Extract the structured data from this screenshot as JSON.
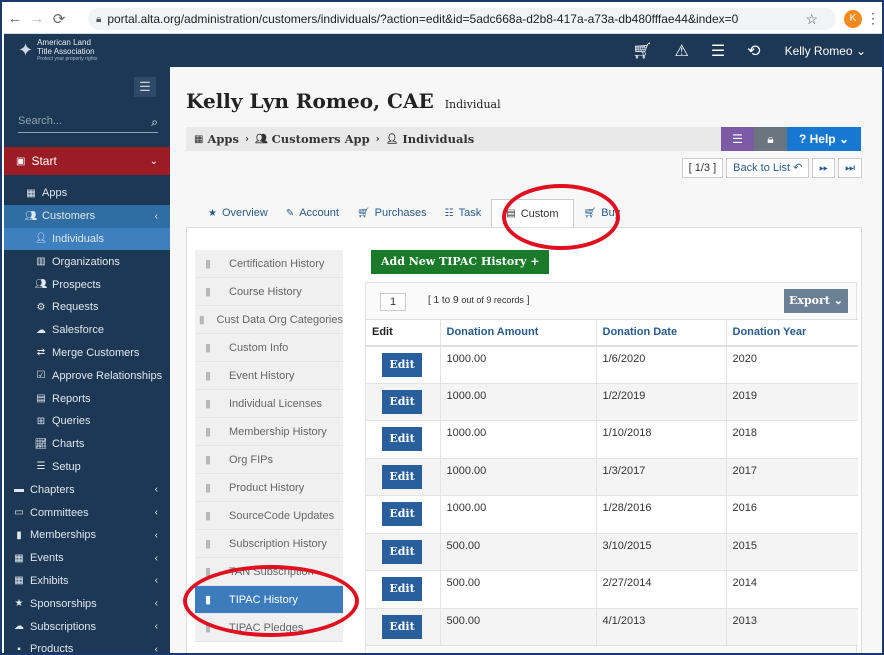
{
  "browser": {
    "url": "portal.alta.org/administration/customers/individuals/?action=edit&id=5adc668a-d2b8-417a-a73a-db480fffae44&index=0",
    "profile_initial": "K"
  },
  "topbar": {
    "logo_line1": "American Land",
    "logo_line2": "Title Association",
    "logo_tag": "Protect your property rights",
    "user_name": "Kelly Romeo"
  },
  "sidebar": {
    "search_placeholder": "Search...",
    "start_label": "Start",
    "items": [
      {
        "label": "Apps",
        "icon": "grid-icon",
        "level": "sub"
      },
      {
        "label": "Customers",
        "icon": "users-icon",
        "level": "sub"
      },
      {
        "label": "Individuals",
        "icon": "user-icon",
        "level": "sub2"
      },
      {
        "label": "Organizations",
        "icon": "building-icon",
        "level": "sub2"
      },
      {
        "label": "Prospects",
        "icon": "users-icon",
        "level": "sub2"
      },
      {
        "label": "Requests",
        "icon": "gear-icon",
        "level": "sub2"
      },
      {
        "label": "Salesforce",
        "icon": "cloud-icon",
        "level": "sub2"
      },
      {
        "label": "Merge Customers",
        "icon": "swap-icon",
        "level": "sub2"
      },
      {
        "label": "Approve Relationships",
        "icon": "check-icon",
        "level": "sub2"
      },
      {
        "label": "Reports",
        "icon": "report-icon",
        "level": "sub2"
      },
      {
        "label": "Queries",
        "icon": "table-icon",
        "level": "sub2"
      },
      {
        "label": "Charts",
        "icon": "chart-icon",
        "level": "sub2"
      },
      {
        "label": "Setup",
        "icon": "list-icon",
        "level": "sub2"
      },
      {
        "label": "Chapters",
        "icon": "book-icon",
        "level": "top"
      },
      {
        "label": "Committees",
        "icon": "briefcase-icon",
        "level": "top"
      },
      {
        "label": "Memberships",
        "icon": "bookmark-icon",
        "level": "top"
      },
      {
        "label": "Events",
        "icon": "calendar-icon",
        "level": "top"
      },
      {
        "label": "Exhibits",
        "icon": "grid-icon",
        "level": "top"
      },
      {
        "label": "Sponsorships",
        "icon": "star-icon",
        "level": "top"
      },
      {
        "label": "Subscriptions",
        "icon": "cloud-icon",
        "level": "top"
      },
      {
        "label": "Products",
        "icon": "box-icon",
        "level": "top"
      }
    ]
  },
  "page": {
    "title": "Kelly Lyn Romeo, CAE",
    "subtitle": "Individual",
    "breadcrumb": [
      "Apps",
      "Customers App",
      "Individuals"
    ],
    "help_label": "Help",
    "pager_count": "[ 1/3 ]",
    "back_label": "Back to List"
  },
  "tabs": [
    {
      "label": "Overview",
      "icon": "star-icon"
    },
    {
      "label": "Account",
      "icon": "edit-icon"
    },
    {
      "label": "Purchases",
      "icon": "cart-icon"
    },
    {
      "label": "Task",
      "icon": "tasks-icon"
    },
    {
      "label": "Custom",
      "icon": "file-icon",
      "active": true
    },
    {
      "label": "Buy",
      "icon": "cart-icon"
    }
  ],
  "custom_list": [
    "Certification History",
    "Course History",
    "Cust Data Org Categories",
    "Custom Info",
    "Event History",
    "Individual Licenses",
    "Membership History",
    "Org FIPs",
    "Product History",
    "SourceCode Updates",
    "Subscription History",
    "TAN Subscription",
    "TIPAC History",
    "TIPAC Pledges"
  ],
  "grid": {
    "add_label": "Add New TIPAC History",
    "page_input": "1",
    "range_text": "[ 1 to 9",
    "range_small": "out of 9 records",
    "range_end": "]",
    "export_label": "Export",
    "columns": [
      "Edit",
      "Donation Amount",
      "Donation Date",
      "Donation Year"
    ],
    "edit_label": "Edit",
    "rows": [
      [
        "1000.00",
        "1/6/2020",
        "2020"
      ],
      [
        "1000.00",
        "1/2/2019",
        "2019"
      ],
      [
        "1000.00",
        "1/10/2018",
        "2018"
      ],
      [
        "1000.00",
        "1/3/2017",
        "2017"
      ],
      [
        "1000.00",
        "1/28/2016",
        "2016"
      ],
      [
        "500.00",
        "3/10/2015",
        "2015"
      ],
      [
        "500.00",
        "2/27/2014",
        "2014"
      ],
      [
        "500.00",
        "4/1/2013",
        "2013"
      ]
    ]
  },
  "colors": {
    "navy": "#1c3854",
    "start_red": "#9b1c24",
    "link_blue": "#2a5a8c",
    "annotation_red": "#e01020"
  }
}
